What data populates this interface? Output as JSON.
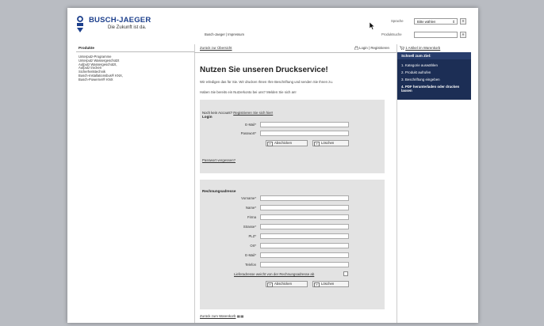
{
  "header": {
    "brand": "BUSCH-JAEGER",
    "tagline": "Die Zukunft ist da.",
    "links": "Busch-Jaeger | Impressum",
    "language_label": "Sprache",
    "language_value": "Bitte wählen",
    "language_arrow": "⇕",
    "go_symbol": "»",
    "product_search_label": "Produktsuche",
    "product_search_value": ""
  },
  "sidebar": {
    "title": "Produkte",
    "items": [
      "Unterputz-Programme",
      "Unterputz Wassergeschützt",
      "Aufputz Wassergeschützt,",
      "Aufputz trocken",
      "Sicherheitstechnik",
      "Busch-Installationsbus® KNX,",
      "Busch-Powernet® KNX"
    ]
  },
  "main": {
    "back_link": "Zurück zur Übersicht",
    "login_register": "Login | Registrieren",
    "title": "Nutzen Sie unseren Druckservice!",
    "intro": "Wir erledigen das für Sie. Wir drucken Ihnen Ihre Beschriftung und senden Sie Ihnen zu.",
    "question": "Haben Sie bereits ein Nutzerkonto bei uns? Melden Sie sich an!",
    "login": {
      "no_account": "Noch kein Account?",
      "register_here": "Registrieren Sie sich hier!",
      "title": "Login",
      "email_label": "E-Mail*",
      "password_label": "Passwort*",
      "submit_label": "Abschicken",
      "delete_label": "Löschen",
      "forgot_link": "Passwort vergessen?"
    },
    "billing": {
      "title": "Rechnungsadresse",
      "fields": [
        "Vorname*",
        "Name*",
        "Firma",
        "Strasse*",
        "PLZ*",
        "Ort*",
        "E-Mail*",
        "Telefon"
      ],
      "delivery_diff": "Lieferadresse weicht von der Rechnungsadresse ab",
      "submit_label": "Abschicken",
      "delete_label": "Löschen"
    },
    "back_to_cart": "Zurück zum Warenkorb"
  },
  "rightbar": {
    "cart_text": "1 Artikel im Warenkorb",
    "steps_title": "Schnell zum Ziel:",
    "steps": [
      "1.  Kategorie auswählen",
      "2.  Produkt aufrufen",
      "3.  Beschriftung eingeben",
      "4.  PDF herunterladen oder drucken lassen"
    ]
  }
}
